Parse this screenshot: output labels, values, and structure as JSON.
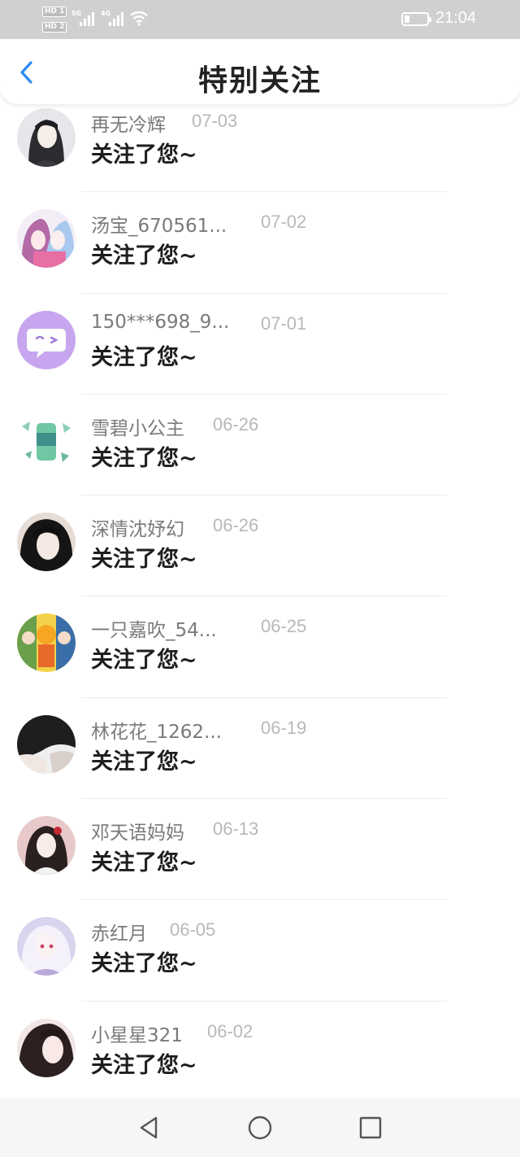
{
  "status_bar": {
    "sim1": "HD 1",
    "sim2": "HD 2",
    "net1": "5G",
    "net2": "4G",
    "time": "21:04"
  },
  "header": {
    "back_icon": "chevron-left-icon",
    "title": "特别关注"
  },
  "colors": {
    "accent": "#2a8cf0",
    "status_bar_bg": "#d0d0d0",
    "name_text": "#7a7a7a",
    "date_text": "#b8b8b8",
    "action_text": "#1e1e1e"
  },
  "items": [
    {
      "name": "再无冷辉",
      "date": "07-03",
      "action": "关注了您~"
    },
    {
      "name": "汤宝_670561...",
      "date": "07-02",
      "action": "关注了您~"
    },
    {
      "name": "150***698_9...",
      "date": "07-01",
      "action": "关注了您~"
    },
    {
      "name": "雪碧小公主",
      "date": "06-26",
      "action": "关注了您~"
    },
    {
      "name": "深情沈妤幻",
      "date": "06-26",
      "action": "关注了您~"
    },
    {
      "name": "一只嘉吹_54...",
      "date": "06-25",
      "action": "关注了您~"
    },
    {
      "name": "林花花_1262...",
      "date": "06-19",
      "action": "关注了您~"
    },
    {
      "name": "邓天语妈妈",
      "date": "06-13",
      "action": "关注了您~"
    },
    {
      "name": "赤红月",
      "date": "06-05",
      "action": "关注了您~"
    },
    {
      "name": "小星星321",
      "date": "06-02",
      "action": "关注了您~"
    }
  ],
  "nav_bar": {
    "back": "triangle-back-icon",
    "home": "circle-home-icon",
    "recents": "square-recents-icon"
  }
}
